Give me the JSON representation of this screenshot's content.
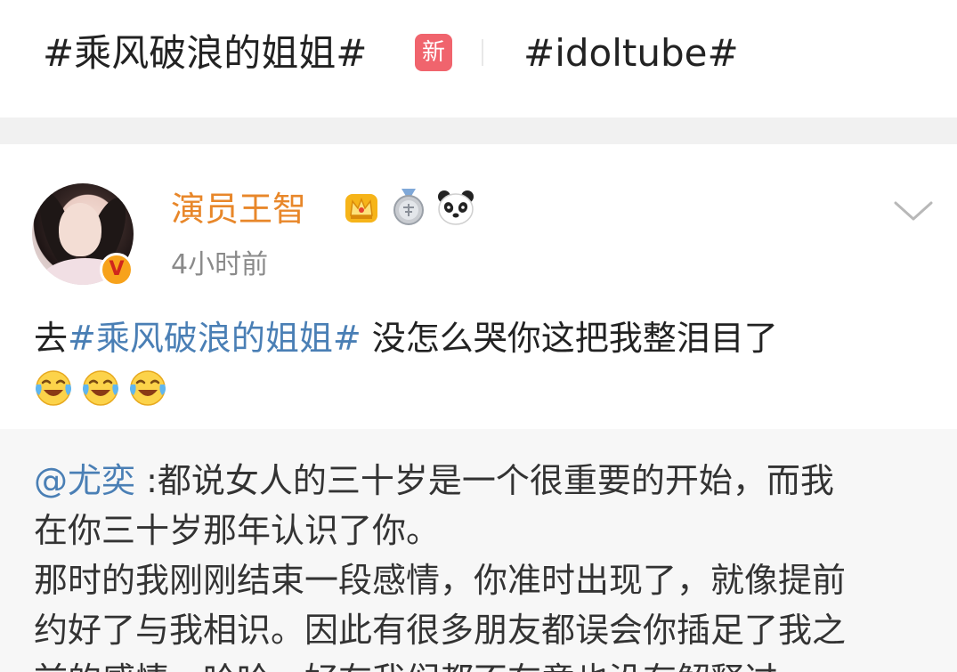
{
  "topics": [
    {
      "label": "#乘风破浪的姐姐#",
      "badge": "新"
    },
    {
      "label": "#idoltube#"
    }
  ],
  "post": {
    "username": "演员王智",
    "verify_mark": "V",
    "timestamp": "4小时前",
    "text_prefix": "去",
    "hashtag": "#乘风破浪的姐姐#",
    "text_suffix": " 没怎么哭你这把我整泪目了",
    "emoji_count": 3,
    "icons": [
      "crown-icon",
      "medal-icon",
      "panda-icon",
      "chevron-down-icon"
    ],
    "colors": {
      "username": "#e8872a",
      "link": "#4a7fb5",
      "new_badge": "#f0646d"
    }
  },
  "repost": {
    "mention": "@尤奕",
    "line1_rest": " :都说女人的三十岁是一个很重要的开始，而我",
    "line2": "在你三十岁那年认识了你。",
    "line3": "那时的我刚刚结束一段感情，你准时出现了，就像提前",
    "line4": "约好了与我相识。因此有很多朋友都误会你插足了我之",
    "line5": "前的感情，哈哈，好在我们都不在意也没有解释过。"
  }
}
